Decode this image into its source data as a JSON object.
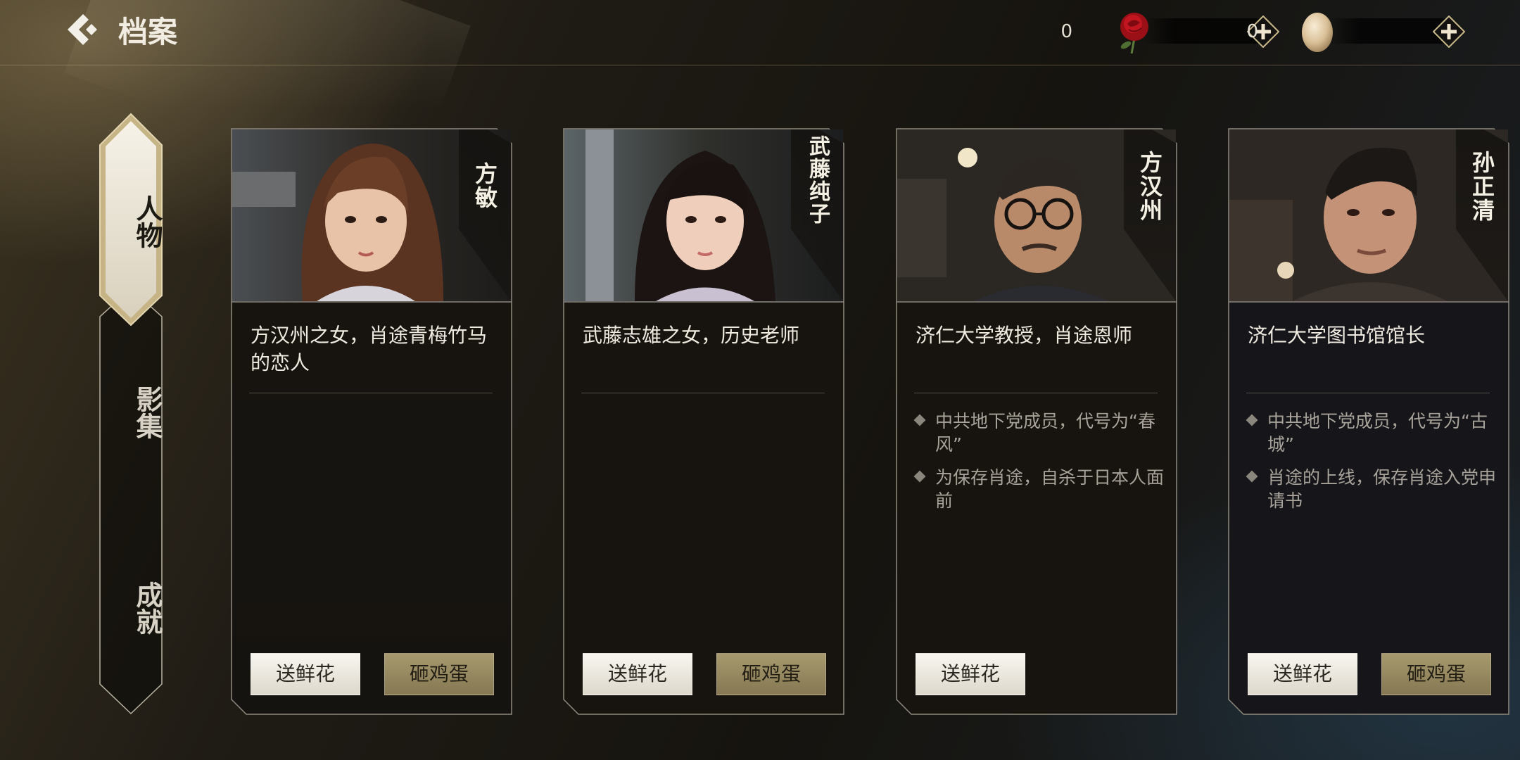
{
  "header": {
    "title": "档案",
    "currencies": [
      {
        "icon": "rose-icon",
        "value": "0"
      },
      {
        "icon": "egg-icon",
        "value": "0"
      }
    ]
  },
  "nav": {
    "items": [
      {
        "label": "人物",
        "active": true
      },
      {
        "label": "影集",
        "active": false
      },
      {
        "label": "成就",
        "active": false
      }
    ]
  },
  "cards": [
    {
      "name": "方敏",
      "description": "方汉州之女，肖途青梅竹马的恋人",
      "facts": [],
      "buttons": {
        "flower": "送鲜花",
        "egg": "砸鸡蛋"
      }
    },
    {
      "name": "武藤纯子",
      "description": "武藤志雄之女，历史老师",
      "facts": [],
      "buttons": {
        "flower": "送鲜花",
        "egg": "砸鸡蛋"
      }
    },
    {
      "name": "方汉州",
      "description": "济仁大学教授，肖途恩师",
      "facts": [
        "中共地下党成员，代号为“春风”",
        "为保存肖途，自杀于日本人面前"
      ],
      "buttons": {
        "flower": "送鲜花"
      }
    },
    {
      "name": "孙正清",
      "description": "济仁大学图书馆馆长",
      "facts": [
        "中共地下党成员，代号为“古城”",
        "肖途的上线，保存肖途入党申请书"
      ],
      "buttons": {
        "flower": "送鲜花",
        "egg": "砸鸡蛋"
      }
    }
  ],
  "colors": {
    "gold": "#c8b88a",
    "egg_button": "#958762",
    "flower_button": "#ece8de"
  }
}
